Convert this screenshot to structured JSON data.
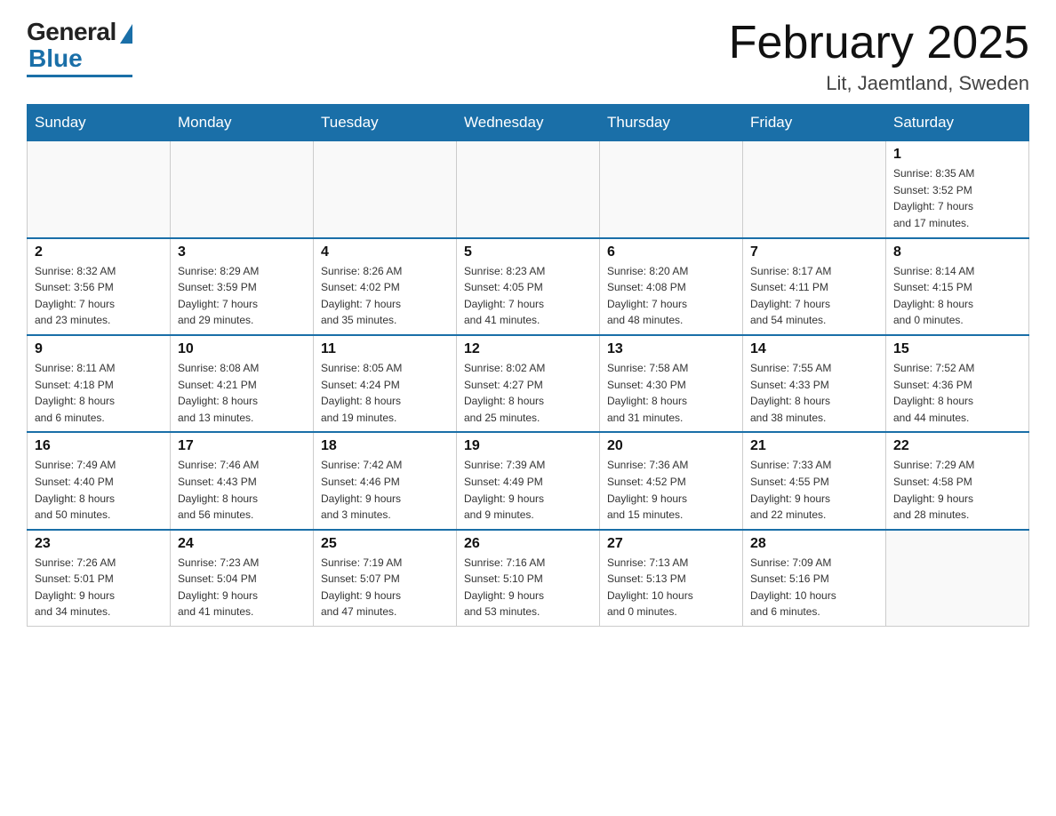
{
  "header": {
    "logo_general": "General",
    "logo_blue": "Blue",
    "month_title": "February 2025",
    "location": "Lit, Jaemtland, Sweden"
  },
  "weekdays": [
    "Sunday",
    "Monday",
    "Tuesday",
    "Wednesday",
    "Thursday",
    "Friday",
    "Saturday"
  ],
  "weeks": [
    [
      {
        "day": "",
        "info": ""
      },
      {
        "day": "",
        "info": ""
      },
      {
        "day": "",
        "info": ""
      },
      {
        "day": "",
        "info": ""
      },
      {
        "day": "",
        "info": ""
      },
      {
        "day": "",
        "info": ""
      },
      {
        "day": "1",
        "info": "Sunrise: 8:35 AM\nSunset: 3:52 PM\nDaylight: 7 hours\nand 17 minutes."
      }
    ],
    [
      {
        "day": "2",
        "info": "Sunrise: 8:32 AM\nSunset: 3:56 PM\nDaylight: 7 hours\nand 23 minutes."
      },
      {
        "day": "3",
        "info": "Sunrise: 8:29 AM\nSunset: 3:59 PM\nDaylight: 7 hours\nand 29 minutes."
      },
      {
        "day": "4",
        "info": "Sunrise: 8:26 AM\nSunset: 4:02 PM\nDaylight: 7 hours\nand 35 minutes."
      },
      {
        "day": "5",
        "info": "Sunrise: 8:23 AM\nSunset: 4:05 PM\nDaylight: 7 hours\nand 41 minutes."
      },
      {
        "day": "6",
        "info": "Sunrise: 8:20 AM\nSunset: 4:08 PM\nDaylight: 7 hours\nand 48 minutes."
      },
      {
        "day": "7",
        "info": "Sunrise: 8:17 AM\nSunset: 4:11 PM\nDaylight: 7 hours\nand 54 minutes."
      },
      {
        "day": "8",
        "info": "Sunrise: 8:14 AM\nSunset: 4:15 PM\nDaylight: 8 hours\nand 0 minutes."
      }
    ],
    [
      {
        "day": "9",
        "info": "Sunrise: 8:11 AM\nSunset: 4:18 PM\nDaylight: 8 hours\nand 6 minutes."
      },
      {
        "day": "10",
        "info": "Sunrise: 8:08 AM\nSunset: 4:21 PM\nDaylight: 8 hours\nand 13 minutes."
      },
      {
        "day": "11",
        "info": "Sunrise: 8:05 AM\nSunset: 4:24 PM\nDaylight: 8 hours\nand 19 minutes."
      },
      {
        "day": "12",
        "info": "Sunrise: 8:02 AM\nSunset: 4:27 PM\nDaylight: 8 hours\nand 25 minutes."
      },
      {
        "day": "13",
        "info": "Sunrise: 7:58 AM\nSunset: 4:30 PM\nDaylight: 8 hours\nand 31 minutes."
      },
      {
        "day": "14",
        "info": "Sunrise: 7:55 AM\nSunset: 4:33 PM\nDaylight: 8 hours\nand 38 minutes."
      },
      {
        "day": "15",
        "info": "Sunrise: 7:52 AM\nSunset: 4:36 PM\nDaylight: 8 hours\nand 44 minutes."
      }
    ],
    [
      {
        "day": "16",
        "info": "Sunrise: 7:49 AM\nSunset: 4:40 PM\nDaylight: 8 hours\nand 50 minutes."
      },
      {
        "day": "17",
        "info": "Sunrise: 7:46 AM\nSunset: 4:43 PM\nDaylight: 8 hours\nand 56 minutes."
      },
      {
        "day": "18",
        "info": "Sunrise: 7:42 AM\nSunset: 4:46 PM\nDaylight: 9 hours\nand 3 minutes."
      },
      {
        "day": "19",
        "info": "Sunrise: 7:39 AM\nSunset: 4:49 PM\nDaylight: 9 hours\nand 9 minutes."
      },
      {
        "day": "20",
        "info": "Sunrise: 7:36 AM\nSunset: 4:52 PM\nDaylight: 9 hours\nand 15 minutes."
      },
      {
        "day": "21",
        "info": "Sunrise: 7:33 AM\nSunset: 4:55 PM\nDaylight: 9 hours\nand 22 minutes."
      },
      {
        "day": "22",
        "info": "Sunrise: 7:29 AM\nSunset: 4:58 PM\nDaylight: 9 hours\nand 28 minutes."
      }
    ],
    [
      {
        "day": "23",
        "info": "Sunrise: 7:26 AM\nSunset: 5:01 PM\nDaylight: 9 hours\nand 34 minutes."
      },
      {
        "day": "24",
        "info": "Sunrise: 7:23 AM\nSunset: 5:04 PM\nDaylight: 9 hours\nand 41 minutes."
      },
      {
        "day": "25",
        "info": "Sunrise: 7:19 AM\nSunset: 5:07 PM\nDaylight: 9 hours\nand 47 minutes."
      },
      {
        "day": "26",
        "info": "Sunrise: 7:16 AM\nSunset: 5:10 PM\nDaylight: 9 hours\nand 53 minutes."
      },
      {
        "day": "27",
        "info": "Sunrise: 7:13 AM\nSunset: 5:13 PM\nDaylight: 10 hours\nand 0 minutes."
      },
      {
        "day": "28",
        "info": "Sunrise: 7:09 AM\nSunset: 5:16 PM\nDaylight: 10 hours\nand 6 minutes."
      },
      {
        "day": "",
        "info": ""
      }
    ]
  ]
}
